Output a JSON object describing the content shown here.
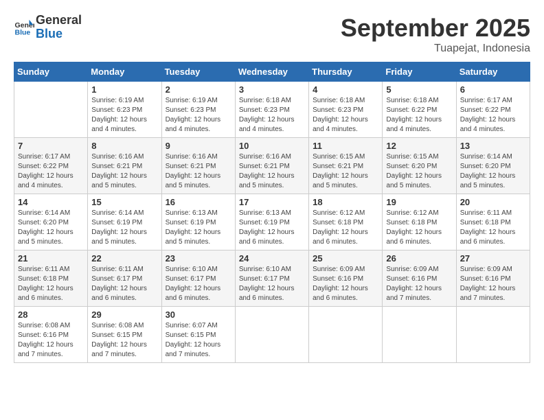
{
  "logo": {
    "text_general": "General",
    "text_blue": "Blue"
  },
  "title": "September 2025",
  "location": "Tuapejat, Indonesia",
  "headers": [
    "Sunday",
    "Monday",
    "Tuesday",
    "Wednesday",
    "Thursday",
    "Friday",
    "Saturday"
  ],
  "weeks": [
    [
      {
        "day": "",
        "info": ""
      },
      {
        "day": "1",
        "info": "Sunrise: 6:19 AM\nSunset: 6:23 PM\nDaylight: 12 hours\nand 4 minutes."
      },
      {
        "day": "2",
        "info": "Sunrise: 6:19 AM\nSunset: 6:23 PM\nDaylight: 12 hours\nand 4 minutes."
      },
      {
        "day": "3",
        "info": "Sunrise: 6:18 AM\nSunset: 6:23 PM\nDaylight: 12 hours\nand 4 minutes."
      },
      {
        "day": "4",
        "info": "Sunrise: 6:18 AM\nSunset: 6:23 PM\nDaylight: 12 hours\nand 4 minutes."
      },
      {
        "day": "5",
        "info": "Sunrise: 6:18 AM\nSunset: 6:22 PM\nDaylight: 12 hours\nand 4 minutes."
      },
      {
        "day": "6",
        "info": "Sunrise: 6:17 AM\nSunset: 6:22 PM\nDaylight: 12 hours\nand 4 minutes."
      }
    ],
    [
      {
        "day": "7",
        "info": "Sunrise: 6:17 AM\nSunset: 6:22 PM\nDaylight: 12 hours\nand 4 minutes."
      },
      {
        "day": "8",
        "info": "Sunrise: 6:16 AM\nSunset: 6:21 PM\nDaylight: 12 hours\nand 5 minutes."
      },
      {
        "day": "9",
        "info": "Sunrise: 6:16 AM\nSunset: 6:21 PM\nDaylight: 12 hours\nand 5 minutes."
      },
      {
        "day": "10",
        "info": "Sunrise: 6:16 AM\nSunset: 6:21 PM\nDaylight: 12 hours\nand 5 minutes."
      },
      {
        "day": "11",
        "info": "Sunrise: 6:15 AM\nSunset: 6:21 PM\nDaylight: 12 hours\nand 5 minutes."
      },
      {
        "day": "12",
        "info": "Sunrise: 6:15 AM\nSunset: 6:20 PM\nDaylight: 12 hours\nand 5 minutes."
      },
      {
        "day": "13",
        "info": "Sunrise: 6:14 AM\nSunset: 6:20 PM\nDaylight: 12 hours\nand 5 minutes."
      }
    ],
    [
      {
        "day": "14",
        "info": "Sunrise: 6:14 AM\nSunset: 6:20 PM\nDaylight: 12 hours\nand 5 minutes."
      },
      {
        "day": "15",
        "info": "Sunrise: 6:14 AM\nSunset: 6:19 PM\nDaylight: 12 hours\nand 5 minutes."
      },
      {
        "day": "16",
        "info": "Sunrise: 6:13 AM\nSunset: 6:19 PM\nDaylight: 12 hours\nand 5 minutes."
      },
      {
        "day": "17",
        "info": "Sunrise: 6:13 AM\nSunset: 6:19 PM\nDaylight: 12 hours\nand 6 minutes."
      },
      {
        "day": "18",
        "info": "Sunrise: 6:12 AM\nSunset: 6:18 PM\nDaylight: 12 hours\nand 6 minutes."
      },
      {
        "day": "19",
        "info": "Sunrise: 6:12 AM\nSunset: 6:18 PM\nDaylight: 12 hours\nand 6 minutes."
      },
      {
        "day": "20",
        "info": "Sunrise: 6:11 AM\nSunset: 6:18 PM\nDaylight: 12 hours\nand 6 minutes."
      }
    ],
    [
      {
        "day": "21",
        "info": "Sunrise: 6:11 AM\nSunset: 6:18 PM\nDaylight: 12 hours\nand 6 minutes."
      },
      {
        "day": "22",
        "info": "Sunrise: 6:11 AM\nSunset: 6:17 PM\nDaylight: 12 hours\nand 6 minutes."
      },
      {
        "day": "23",
        "info": "Sunrise: 6:10 AM\nSunset: 6:17 PM\nDaylight: 12 hours\nand 6 minutes."
      },
      {
        "day": "24",
        "info": "Sunrise: 6:10 AM\nSunset: 6:17 PM\nDaylight: 12 hours\nand 6 minutes."
      },
      {
        "day": "25",
        "info": "Sunrise: 6:09 AM\nSunset: 6:16 PM\nDaylight: 12 hours\nand 6 minutes."
      },
      {
        "day": "26",
        "info": "Sunrise: 6:09 AM\nSunset: 6:16 PM\nDaylight: 12 hours\nand 7 minutes."
      },
      {
        "day": "27",
        "info": "Sunrise: 6:09 AM\nSunset: 6:16 PM\nDaylight: 12 hours\nand 7 minutes."
      }
    ],
    [
      {
        "day": "28",
        "info": "Sunrise: 6:08 AM\nSunset: 6:16 PM\nDaylight: 12 hours\nand 7 minutes."
      },
      {
        "day": "29",
        "info": "Sunrise: 6:08 AM\nSunset: 6:15 PM\nDaylight: 12 hours\nand 7 minutes."
      },
      {
        "day": "30",
        "info": "Sunrise: 6:07 AM\nSunset: 6:15 PM\nDaylight: 12 hours\nand 7 minutes."
      },
      {
        "day": "",
        "info": ""
      },
      {
        "day": "",
        "info": ""
      },
      {
        "day": "",
        "info": ""
      },
      {
        "day": "",
        "info": ""
      }
    ]
  ]
}
